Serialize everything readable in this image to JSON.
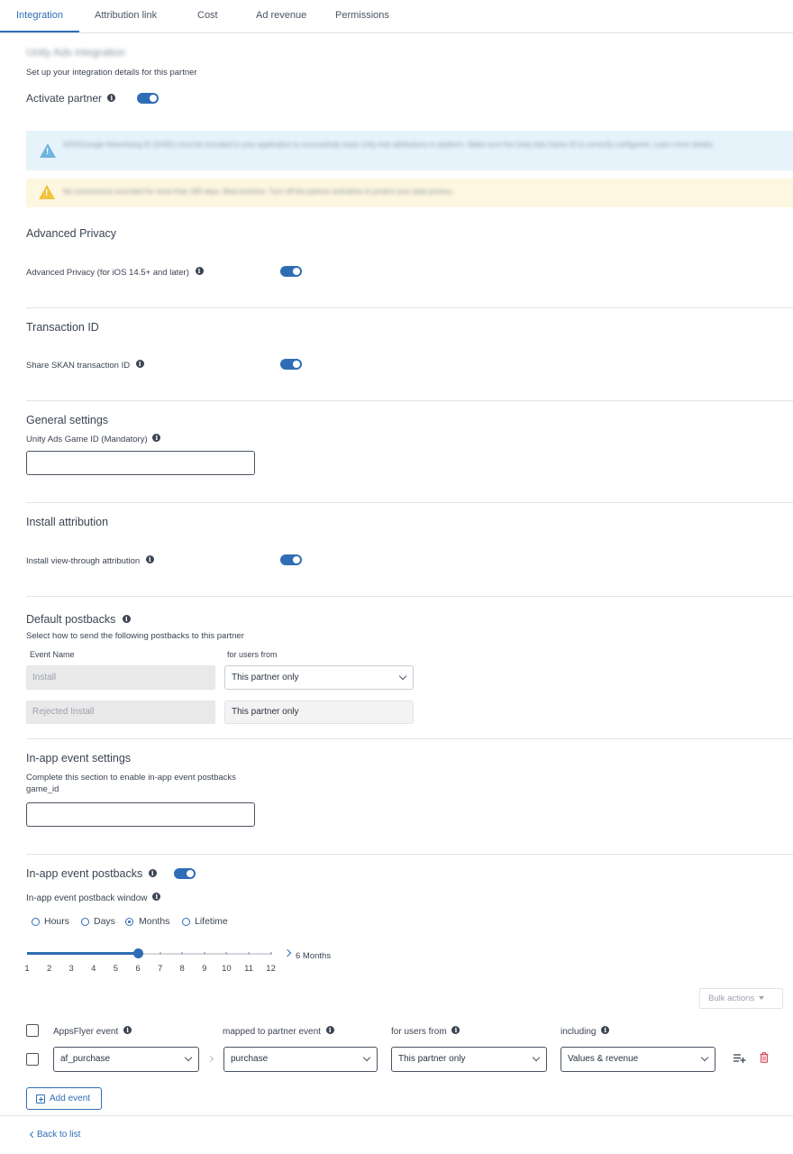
{
  "tabs": [
    {
      "label": "Integration",
      "active": true
    },
    {
      "label": "Attribution link"
    },
    {
      "label": "Cost"
    },
    {
      "label": "Ad revenue"
    },
    {
      "label": "Permissions"
    }
  ],
  "integration": {
    "blurred_title": "Unity Ads integration",
    "subtitle": "Set up your integration details for this partner",
    "activate_label": "Activate partner",
    "activate_on": true
  },
  "banners": {
    "info_text": "IDFA/Google Advertising ID (GAID) must be included in your application to successfully track Unity Ads attributions in platform. Make sure the Unity Ads Game ID is correctly configured. Learn more details.",
    "warning_text": "No conversions recorded for more than 180 days. Best practice: Turn off the partner activation to protect your data privacy."
  },
  "advanced_privacy": {
    "title": "Advanced Privacy",
    "label": "Advanced Privacy (for iOS 14.5+ and later)",
    "on": true
  },
  "transaction_id": {
    "title": "Transaction ID",
    "label": "Share SKAN transaction ID",
    "on": true
  },
  "general": {
    "title": "General settings",
    "game_id_label": "Unity Ads Game ID (Mandatory)",
    "game_id_value": ""
  },
  "install_attribution": {
    "title": "Install attribution",
    "label": "Install view-through attribution",
    "on": true
  },
  "default_postbacks": {
    "title": "Default postbacks",
    "subtitle": "Select how to send the following postbacks to this partner",
    "col_event": "Event Name",
    "col_users": "for users from",
    "rows": [
      {
        "event": "Install",
        "users": "This partner only",
        "dropdown": true
      },
      {
        "event": "Rejected Install",
        "users": "This partner only",
        "dropdown": false
      }
    ]
  },
  "inapp_settings": {
    "title": "In-app event settings",
    "subtitle": "Complete this section to enable in-app event postbacks",
    "field_label": "game_id",
    "field_value": ""
  },
  "inapp_postbacks": {
    "title": "In-app event postbacks",
    "on": true,
    "window_label": "In-app event postback window",
    "window_options": [
      "Hours",
      "Days",
      "Months",
      "Lifetime"
    ],
    "window_selected": "Months",
    "slider_ticks": [
      "1",
      "2",
      "3",
      "4",
      "5",
      "6",
      "7",
      "8",
      "9",
      "10",
      "11",
      "12"
    ],
    "slider_value": 6,
    "slider_readout": "6 Months",
    "bulk_actions": "Bulk actions",
    "columns": {
      "af_event": "AppsFlyer event",
      "partner_event": "mapped to partner event",
      "users": "for users from",
      "including": "including"
    },
    "rows": [
      {
        "af_event": "af_purchase",
        "partner_event": "purchase",
        "users": "This partner only",
        "including": "Values & revenue"
      }
    ],
    "add_event": "Add event"
  },
  "footer": {
    "back": "Back to list"
  },
  "colors": {
    "accent": "#2f6db5",
    "warning": "#f0c33c",
    "info": "#6fb4dd",
    "delete": "#d9455b"
  }
}
